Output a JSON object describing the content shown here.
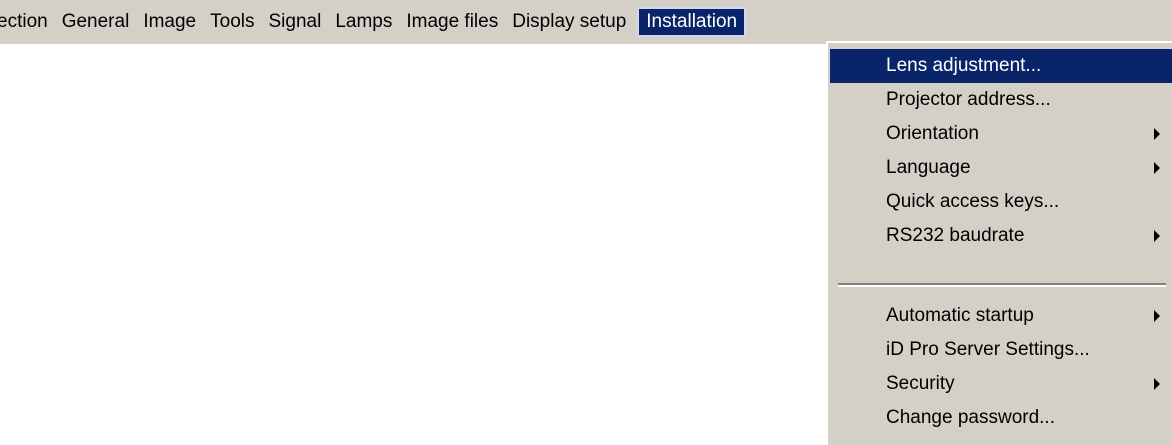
{
  "menubar": {
    "items": [
      {
        "label": "ection"
      },
      {
        "label": "General"
      },
      {
        "label": "Image"
      },
      {
        "label": "Tools"
      },
      {
        "label": "Signal"
      },
      {
        "label": "Lamps"
      },
      {
        "label": "Image files"
      },
      {
        "label": "Display setup"
      },
      {
        "label": "Installation"
      }
    ]
  },
  "dropdown": {
    "items": [
      {
        "label": "Lens adjustment..."
      },
      {
        "label": "Projector address..."
      },
      {
        "label": "Orientation"
      },
      {
        "label": "Language"
      },
      {
        "label": "Quick access keys..."
      },
      {
        "label": "RS232 baudrate"
      },
      {
        "label": "Automatic startup"
      },
      {
        "label": "iD Pro Server Settings..."
      },
      {
        "label": "Security"
      },
      {
        "label": "Change password..."
      }
    ]
  },
  "colors": {
    "menu_background": "#d4d0c8",
    "highlight": "#0a246a",
    "highlight_text": "#ffffff"
  },
  "icons": {
    "submenu": "triangle-right-icon"
  }
}
